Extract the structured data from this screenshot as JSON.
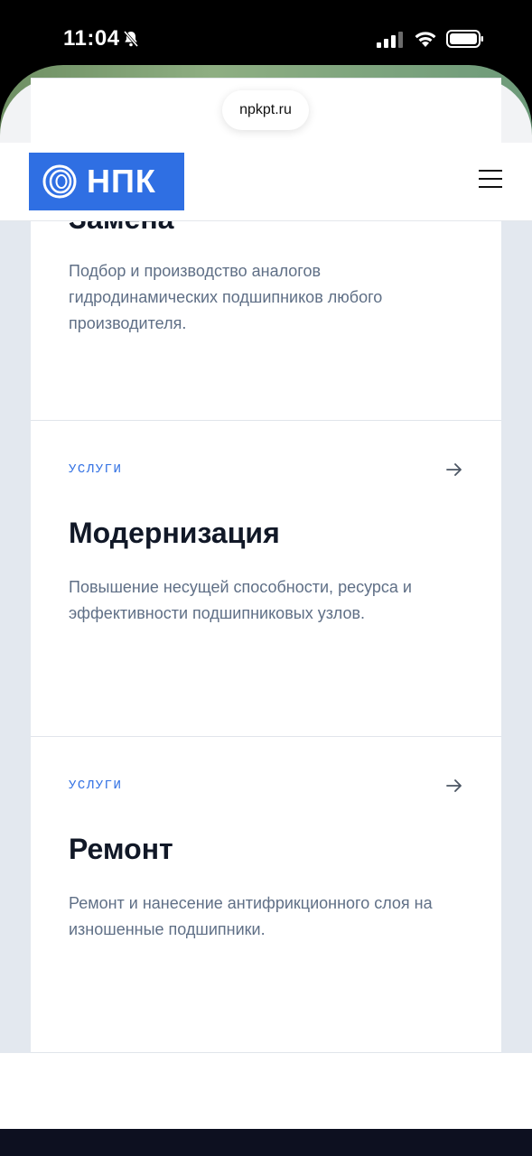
{
  "status_bar": {
    "time": "11:04"
  },
  "browser": {
    "url": "npkpt.ru"
  },
  "header": {
    "logo_text": "НПК"
  },
  "cards": [
    {
      "title": "Замена",
      "description": "Подбор и производство аналогов гидродинамических подшипников любого производителя."
    },
    {
      "label": "УСЛУГИ",
      "title": "Модернизация",
      "description": "Повышение несущей способности, ресурса и эффективности подшипниковых узлов."
    },
    {
      "label": "УСЛУГИ",
      "title": "Ремонт",
      "description": "Ремонт и нанесение антифрикционного слоя на изношенные подшипники."
    }
  ],
  "colors": {
    "accent": "#2f6fe3",
    "text": "#111827",
    "muted": "#5f6f86",
    "page_bg": "#e3e8ef"
  }
}
